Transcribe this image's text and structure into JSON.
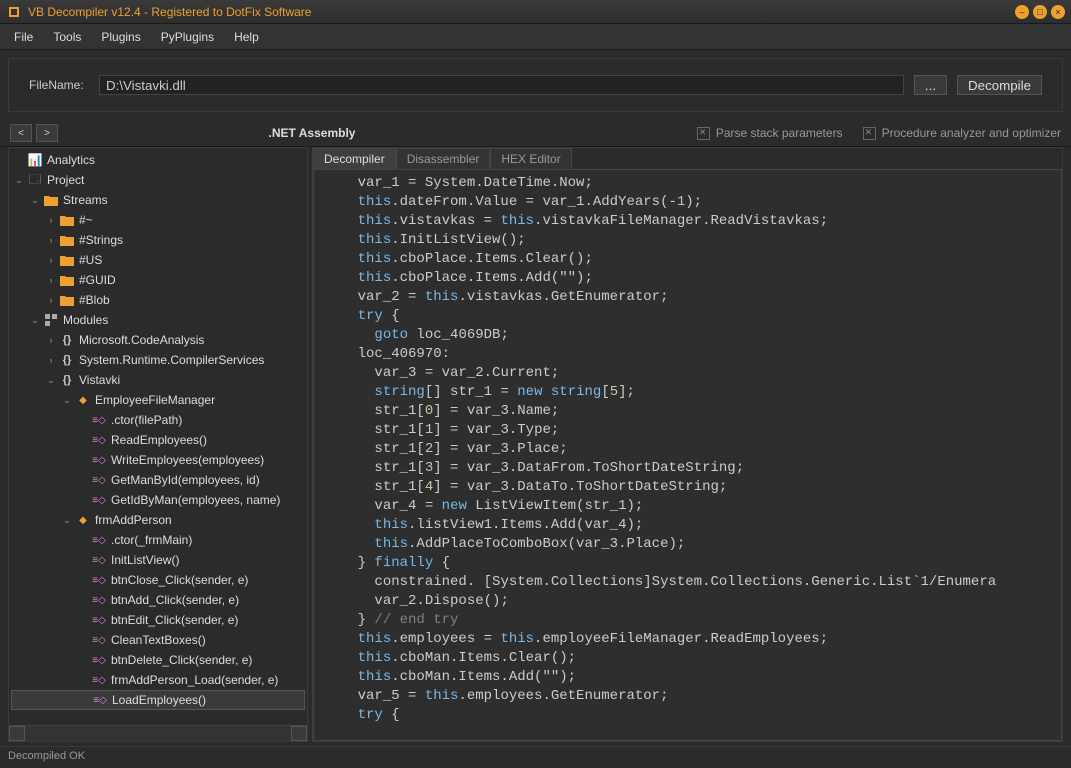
{
  "title": "VB Decompiler v12.4 - Registered to DotFix Software",
  "menu": {
    "file": "File",
    "tools": "Tools",
    "plugins": "Plugins",
    "pyplugins": "PyPlugins",
    "help": "Help"
  },
  "filename": {
    "label": "FileName:",
    "value": "D:\\Vistavki.dll",
    "browse": "...",
    "decompile": "Decompile"
  },
  "infobar": {
    "back": "<",
    "fwd": ">",
    "title": ".NET Assembly",
    "opt1": "Parse stack parameters",
    "opt2": "Procedure analyzer and optimizer"
  },
  "tabs": {
    "decompiler": "Decompiler",
    "disassembler": "Disassembler",
    "hex": "HEX Editor"
  },
  "tree": {
    "analytics": "Analytics",
    "project": "Project",
    "streams": "Streams",
    "s_hash": "#~",
    "s_strings": "#Strings",
    "s_us": "#US",
    "s_guid": "#GUID",
    "s_blob": "#Blob",
    "modules": "Modules",
    "m_codeanalysis": "Microsoft.CodeAnalysis",
    "m_compilerservices": "System.Runtime.CompilerServices",
    "m_vistavki": "Vistavki",
    "c_empmgr": "EmployeeFileManager",
    "e_ctor": ".ctor(filePath)",
    "e_read": "ReadEmployees()",
    "e_write": "WriteEmployees(employees)",
    "e_getman": "GetManById(employees, id)",
    "e_getid": "GetIdByMan(employees, name)",
    "c_frm": "frmAddPerson",
    "f_ctor": ".ctor(_frmMain)",
    "f_initlv": "InitListView()",
    "f_btnclose": "btnClose_Click(sender, e)",
    "f_btnadd": "btnAdd_Click(sender, e)",
    "f_btnedit": "btnEdit_Click(sender, e)",
    "f_clean": "CleanTextBoxes()",
    "f_btndel": "btnDelete_Click(sender, e)",
    "f_load": "frmAddPerson_Load(sender, e)",
    "f_loademp": "LoadEmployees()"
  },
  "code": [
    {
      "indent": 2,
      "t": [
        {
          "s": "var_1 = System.DateTime.Now;"
        }
      ]
    },
    {
      "indent": 2,
      "t": [
        {
          "c": "kw",
          "s": "this"
        },
        {
          "s": ".dateFrom.Value = var_1.AddYears(-"
        },
        {
          "c": "num",
          "s": "1"
        },
        {
          "s": ");"
        }
      ]
    },
    {
      "indent": 2,
      "t": [
        {
          "c": "kw",
          "s": "this"
        },
        {
          "s": ".vistavkas = "
        },
        {
          "c": "kw",
          "s": "this"
        },
        {
          "s": ".vistavkaFileManager.ReadVistavkas;"
        }
      ]
    },
    {
      "indent": 2,
      "t": [
        {
          "c": "kw",
          "s": "this"
        },
        {
          "s": ".InitListView();"
        }
      ]
    },
    {
      "indent": 2,
      "t": [
        {
          "c": "kw",
          "s": "this"
        },
        {
          "s": ".cboPlace.Items.Clear();"
        }
      ]
    },
    {
      "indent": 2,
      "t": [
        {
          "c": "kw",
          "s": "this"
        },
        {
          "s": ".cboPlace.Items.Add(\"\");"
        }
      ]
    },
    {
      "indent": 2,
      "t": [
        {
          "s": "var_2 = "
        },
        {
          "c": "kw",
          "s": "this"
        },
        {
          "s": ".vistavkas.GetEnumerator;"
        }
      ]
    },
    {
      "indent": 2,
      "t": [
        {
          "c": "kw",
          "s": "try"
        },
        {
          "s": " {"
        }
      ]
    },
    {
      "indent": 3,
      "t": [
        {
          "c": "kw",
          "s": "goto"
        },
        {
          "s": " loc_4069DB;"
        }
      ]
    },
    {
      "indent": 2,
      "t": [
        {
          "s": "loc_406970:"
        }
      ]
    },
    {
      "indent": 3,
      "t": [
        {
          "s": "var_3 = var_2.Current;"
        }
      ]
    },
    {
      "indent": 3,
      "t": [
        {
          "c": "kw",
          "s": "string"
        },
        {
          "s": "[] str_1 = "
        },
        {
          "c": "kw",
          "s": "new"
        },
        {
          "s": " "
        },
        {
          "c": "kw",
          "s": "string"
        },
        {
          "s": "["
        },
        {
          "c": "num",
          "s": "5"
        },
        {
          "s": "];"
        }
      ]
    },
    {
      "indent": 3,
      "t": [
        {
          "s": "str_1["
        },
        {
          "c": "num",
          "s": "0"
        },
        {
          "s": "] = var_3.Name;"
        }
      ]
    },
    {
      "indent": 3,
      "t": [
        {
          "s": "str_1["
        },
        {
          "c": "num",
          "s": "1"
        },
        {
          "s": "] = var_3.Type;"
        }
      ]
    },
    {
      "indent": 3,
      "t": [
        {
          "s": "str_1["
        },
        {
          "c": "num",
          "s": "2"
        },
        {
          "s": "] = var_3.Place;"
        }
      ]
    },
    {
      "indent": 3,
      "t": [
        {
          "s": "str_1["
        },
        {
          "c": "num",
          "s": "3"
        },
        {
          "s": "] = var_3.DataFrom.ToShortDateString;"
        }
      ]
    },
    {
      "indent": 3,
      "t": [
        {
          "s": "str_1["
        },
        {
          "c": "num",
          "s": "4"
        },
        {
          "s": "] = var_3.DataTo.ToShortDateString;"
        }
      ]
    },
    {
      "indent": 3,
      "t": [
        {
          "s": "var_4 = "
        },
        {
          "c": "kw",
          "s": "new"
        },
        {
          "s": " ListViewItem(str_1);"
        }
      ]
    },
    {
      "indent": 3,
      "t": [
        {
          "c": "kw",
          "s": "this"
        },
        {
          "s": ".listView1.Items.Add(var_4);"
        }
      ]
    },
    {
      "indent": 3,
      "t": [
        {
          "c": "kw",
          "s": "this"
        },
        {
          "s": ".AddPlaceToComboBox(var_3.Place);"
        }
      ]
    },
    {
      "indent": 2,
      "t": [
        {
          "s": "} "
        },
        {
          "c": "kw",
          "s": "finally"
        },
        {
          "s": " {"
        }
      ]
    },
    {
      "indent": 3,
      "t": [
        {
          "s": "constrained. [System.Collections]System.Collections.Generic.List`1/Enumera"
        }
      ]
    },
    {
      "indent": 3,
      "t": [
        {
          "s": "var_2.Dispose();"
        }
      ]
    },
    {
      "indent": 2,
      "t": [
        {
          "s": "} "
        },
        {
          "c": "cmt",
          "s": "// end try"
        }
      ]
    },
    {
      "indent": 2,
      "t": [
        {
          "c": "kw",
          "s": "this"
        },
        {
          "s": ".employees = "
        },
        {
          "c": "kw",
          "s": "this"
        },
        {
          "s": ".employeeFileManager.ReadEmployees;"
        }
      ]
    },
    {
      "indent": 2,
      "t": [
        {
          "c": "kw",
          "s": "this"
        },
        {
          "s": ".cboMan.Items.Clear();"
        }
      ]
    },
    {
      "indent": 2,
      "t": [
        {
          "c": "kw",
          "s": "this"
        },
        {
          "s": ".cboMan.Items.Add(\"\");"
        }
      ]
    },
    {
      "indent": 2,
      "t": [
        {
          "s": "var_5 = "
        },
        {
          "c": "kw",
          "s": "this"
        },
        {
          "s": ".employees.GetEnumerator;"
        }
      ]
    },
    {
      "indent": 2,
      "t": [
        {
          "c": "kw",
          "s": "try"
        },
        {
          "s": " {"
        }
      ]
    }
  ],
  "status": "Decompiled OK"
}
